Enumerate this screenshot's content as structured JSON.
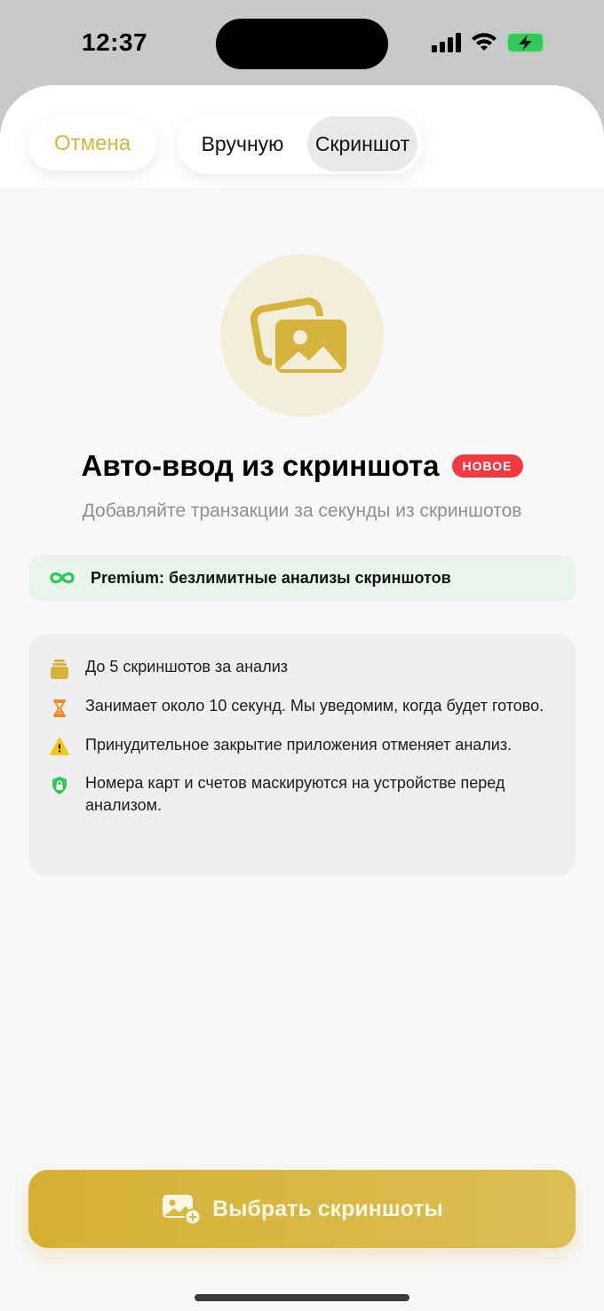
{
  "status": {
    "time": "12:37"
  },
  "header": {
    "cancel_label": "Отмена",
    "segments": [
      "Вручную",
      "Скриншот"
    ],
    "selected_segment": "Скриншот"
  },
  "hero": {
    "icon": "photos-icon",
    "title": "Авто-ввод из скриншота",
    "badge": "НОВОЕ",
    "subtitle": "Добавляйте транзакции за секунды из скриншотов"
  },
  "premium": {
    "icon": "infinity-icon",
    "text": "Premium: безлимитные анализы скриншотов"
  },
  "info": {
    "items": [
      {
        "icon": "stack-icon",
        "text": "До 5 скриншотов за анализ"
      },
      {
        "icon": "hourglass-icon",
        "text": "Занимает около 10 секунд. Мы уведомим, когда будет готово."
      },
      {
        "icon": "warning-icon",
        "text": "Принудительное закрытие приложения отменяет анализ."
      },
      {
        "icon": "shield-lock-icon",
        "text": "Номера карт и счетов маскируются на устройстве перед анализом."
      }
    ]
  },
  "cta": {
    "icon": "photo-add-icon",
    "label": "Выбрать скриншоты"
  },
  "colors": {
    "accent": "#d7b53e",
    "badge": "#ee3a40",
    "premium_bg": "#e8f4ec",
    "premium_icon": "#34c759"
  }
}
